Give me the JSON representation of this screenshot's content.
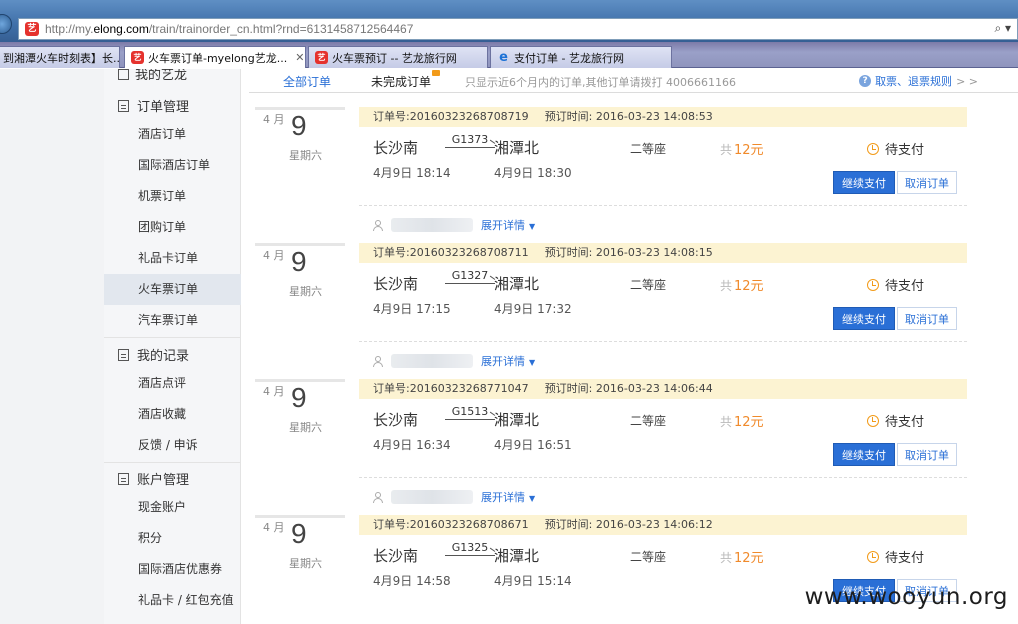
{
  "browser": {
    "url_prefix": "http://my.",
    "url_domain": "elong.com",
    "url_rest": "/train/trainorder_cn.html?rnd=6131458712564467",
    "url_tools": "⌕ ▾",
    "tabs": [
      {
        "label": "到湘潭火车时刻表】长...",
        "close": ""
      },
      {
        "label": "火车票订单-myelong艺龙...",
        "close": "✕"
      },
      {
        "label": "火车票预订 -- 艺龙旅行网",
        "close": ""
      },
      {
        "label": "支付订单 - 艺龙旅行网",
        "close": ""
      }
    ]
  },
  "sidebar": {
    "top_partial": "我的艺龙",
    "sections": [
      {
        "title": "订单管理",
        "items": [
          "酒店订单",
          "国际酒店订单",
          "机票订单",
          "团购订单",
          "礼品卡订单",
          "火车票订单",
          "汽车票订单"
        ]
      },
      {
        "title": "我的记录",
        "items": [
          "酒店点评",
          "酒店收藏",
          "反馈 / 申诉"
        ]
      },
      {
        "title": "账户管理",
        "items": [
          "现金账户",
          "积分",
          "国际酒店优惠券",
          "礼品卡 / 红包充值"
        ]
      }
    ],
    "active_item": "火车票订单"
  },
  "order_tabs": {
    "all": "全部订单",
    "unfinished": "未完成订单",
    "tip": "只显示近6个月内的订单,其他订单请拨打 4006661166",
    "rules": "取票、退票规则",
    "rules_arrow": "> >"
  },
  "orders": [
    {
      "month": "4 月",
      "day": "9",
      "weekday": "星期六",
      "order_no": "订单号:20160323268708719",
      "book_time": "预订时间: 2016-03-23 14:08:53",
      "from": "长沙南",
      "train": "G1373",
      "to": "湘潭北",
      "dep": "4月9日 18:14",
      "arr": "4月9日 18:30",
      "seat": "二等座",
      "price_prefix": "共",
      "price": "12元",
      "status": "待支付",
      "pay": "继续支付",
      "cancel": "取消订单",
      "expand": "展开详情"
    },
    {
      "month": "4 月",
      "day": "9",
      "weekday": "星期六",
      "order_no": "订单号:20160323268708711",
      "book_time": "预订时间: 2016-03-23 14:08:15",
      "from": "长沙南",
      "train": "G1327",
      "to": "湘潭北",
      "dep": "4月9日 17:15",
      "arr": "4月9日 17:32",
      "seat": "二等座",
      "price_prefix": "共",
      "price": "12元",
      "status": "待支付",
      "pay": "继续支付",
      "cancel": "取消订单",
      "expand": "展开详情"
    },
    {
      "month": "4 月",
      "day": "9",
      "weekday": "星期六",
      "order_no": "订单号:20160323268771047",
      "book_time": "预订时间: 2016-03-23 14:06:44",
      "from": "长沙南",
      "train": "G1513",
      "to": "湘潭北",
      "dep": "4月9日 16:34",
      "arr": "4月9日 16:51",
      "seat": "二等座",
      "price_prefix": "共",
      "price": "12元",
      "status": "待支付",
      "pay": "继续支付",
      "cancel": "取消订单",
      "expand": "展开详情"
    },
    {
      "month": "4 月",
      "day": "9",
      "weekday": "星期六",
      "order_no": "订单号:20160323268708671",
      "book_time": "预订时间: 2016-03-23 14:06:12",
      "from": "长沙南",
      "train": "G1325",
      "to": "湘潭北",
      "dep": "4月9日 14:58",
      "arr": "4月9日 15:14",
      "seat": "二等座",
      "price_prefix": "共",
      "price": "12元",
      "status": "待支付",
      "pay": "继续支付",
      "cancel": "取消订单",
      "expand": ""
    }
  ],
  "watermark": "www.wooyun.org",
  "colors": {
    "accent": "#2a6fd6",
    "price": "#f08a2b",
    "order_header_bg": "#fcf3d2",
    "status_icon": "#f29b1a"
  }
}
